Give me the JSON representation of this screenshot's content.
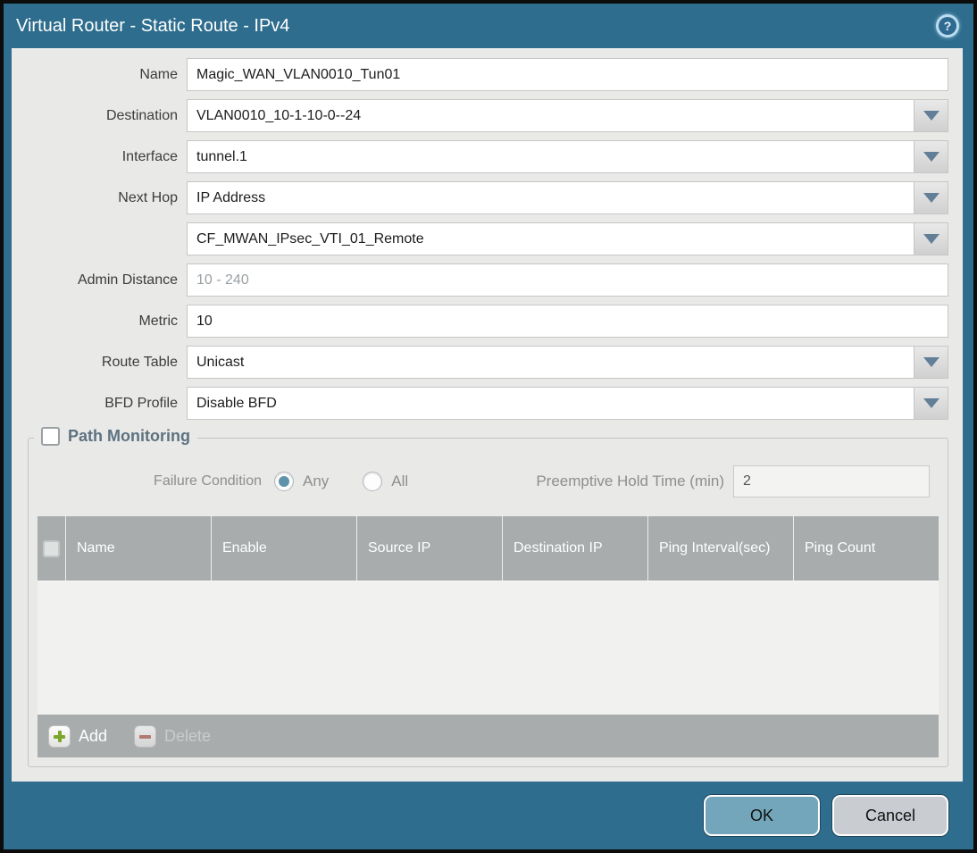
{
  "dialog": {
    "title": "Virtual Router - Static Route - IPv4",
    "help_glyph": "?"
  },
  "fields": {
    "name": {
      "label": "Name",
      "value": "Magic_WAN_VLAN0010_Tun01"
    },
    "destination": {
      "label": "Destination",
      "value": "VLAN0010_10-1-10-0--24"
    },
    "interface": {
      "label": "Interface",
      "value": "tunnel.1"
    },
    "next_hop": {
      "label": "Next Hop",
      "value": "IP Address"
    },
    "next_hop_address": {
      "label": "",
      "value": "CF_MWAN_IPsec_VTI_01_Remote"
    },
    "admin_distance": {
      "label": "Admin Distance",
      "value": "",
      "placeholder": "10 - 240"
    },
    "metric": {
      "label": "Metric",
      "value": "10"
    },
    "route_table": {
      "label": "Route Table",
      "value": "Unicast"
    },
    "bfd_profile": {
      "label": "BFD Profile",
      "value": "Disable BFD"
    }
  },
  "path_monitoring": {
    "title": "Path Monitoring",
    "enabled": false,
    "failure_condition": {
      "label": "Failure Condition",
      "options": [
        "Any",
        "All"
      ],
      "selected": "Any"
    },
    "preemptive_hold": {
      "label": "Preemptive Hold Time (min)",
      "value": "2"
    },
    "table": {
      "columns": [
        "Name",
        "Enable",
        "Source IP",
        "Destination IP",
        "Ping Interval(sec)",
        "Ping Count"
      ],
      "rows": []
    },
    "add_label": "Add",
    "delete_label": "Delete"
  },
  "footer": {
    "ok_label": "OK",
    "cancel_label": "Cancel"
  },
  "colors": {
    "titlebar_teal": "#2e6d8d",
    "content_bg": "#e9e9e8",
    "table_header_grey": "#a8acad",
    "ok_button": "#74a6bb",
    "cancel_button": "#c9cdd1",
    "radio_selected": "#5e93ab",
    "add_plus_green": "#7da62c",
    "delete_minus_red": "#b4685f"
  }
}
